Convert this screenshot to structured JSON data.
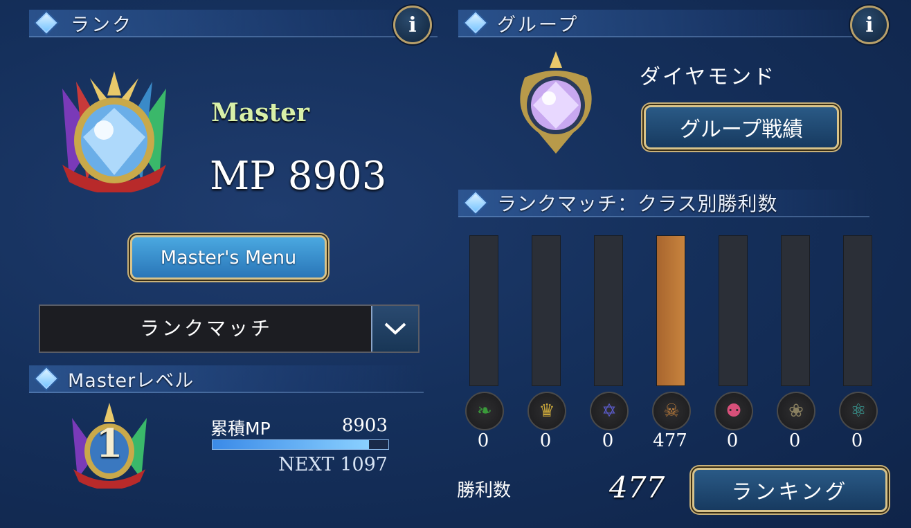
{
  "rank_panel": {
    "title": "ランク",
    "info_icon": "i",
    "rank_name": "Master",
    "mp_label": "MP 8903",
    "masters_menu_label": "Master's Menu",
    "dropdown_value": "ランクマッチ"
  },
  "master_level": {
    "title": "Masterレベル",
    "level": "1",
    "accum_label": "累積MP",
    "accum_value": "8903",
    "progress": 0.89,
    "next_label": "NEXT 1097"
  },
  "group_panel": {
    "title": "グループ",
    "info_icon": "i",
    "group_name": "ダイヤモンド",
    "group_record_button": "グループ戦績"
  },
  "class_wins": {
    "title": "ランクマッチ：クラス別勝利数",
    "max": 477,
    "classes": [
      {
        "icon": "leaf-icon",
        "count": "0",
        "value": 0,
        "color": "#3a9a3a"
      },
      {
        "icon": "crown-icon",
        "count": "0",
        "value": 0,
        "color": "#c9a63a"
      },
      {
        "icon": "magic-circle-icon",
        "count": "0",
        "value": 0,
        "color": "#5a5ac8"
      },
      {
        "icon": "dragon-icon",
        "count": "477",
        "value": 477,
        "color": "#b87a3a"
      },
      {
        "icon": "skull-icon",
        "count": "0",
        "value": 0,
        "color": "#d8507a"
      },
      {
        "icon": "wing-icon",
        "count": "0",
        "value": 0,
        "color": "#8a8060"
      },
      {
        "icon": "spiral-icon",
        "count": "0",
        "value": 0,
        "color": "#3aa8a0"
      }
    ],
    "wins_label": "勝利数",
    "wins_value": "477",
    "ranking_button": "ランキング"
  },
  "colors": {
    "bar_fill": "#b8733a",
    "bar_empty": "#2b2f37",
    "gold": "#d8c38a"
  }
}
